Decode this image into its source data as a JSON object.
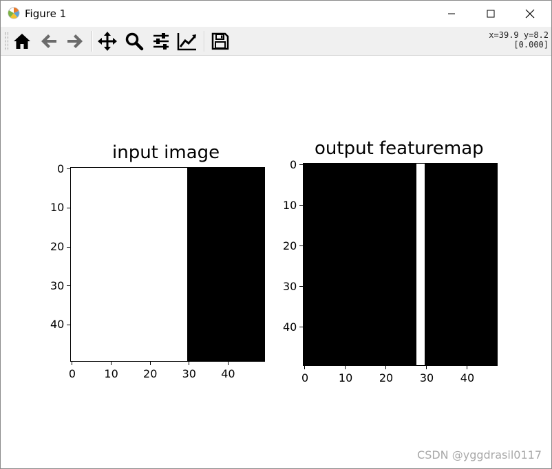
{
  "window": {
    "title": "Figure 1"
  },
  "toolbar": {
    "buttons": [
      "home-icon",
      "back-arrow-icon",
      "forward-arrow-icon",
      "pan-icon",
      "zoom-icon",
      "configure-subplots-icon",
      "edit-axis-icon",
      "save-icon"
    ],
    "coord_line1": "x=39.9 y=8.2",
    "coord_line2": "[0.000]"
  },
  "chart_data": [
    {
      "type": "heatmap",
      "title": "input image",
      "colormap": "gray",
      "shape": [
        50,
        50
      ],
      "description_of_values": "columns 0-29 white (1), columns 30-49 black (0)",
      "white_columns": [
        0,
        29
      ],
      "xticks": [
        0,
        10,
        20,
        30,
        40
      ],
      "yticks": [
        0,
        10,
        20,
        30,
        40
      ],
      "xlim": [
        -0.5,
        49.5
      ],
      "ylim": [
        49.5,
        -0.5
      ]
    },
    {
      "type": "heatmap",
      "title": "output featuremap",
      "colormap": "gray",
      "shape": [
        50,
        48
      ],
      "white_columns": [
        28,
        29
      ],
      "xticks": [
        0,
        10,
        20,
        30,
        40
      ],
      "yticks": [
        0,
        10,
        20,
        30,
        40
      ],
      "xlim": [
        -0.5,
        47.5
      ],
      "ylim": [
        49.5,
        -0.5
      ]
    }
  ],
  "watermark": "CSDN @yggdrasil0117"
}
